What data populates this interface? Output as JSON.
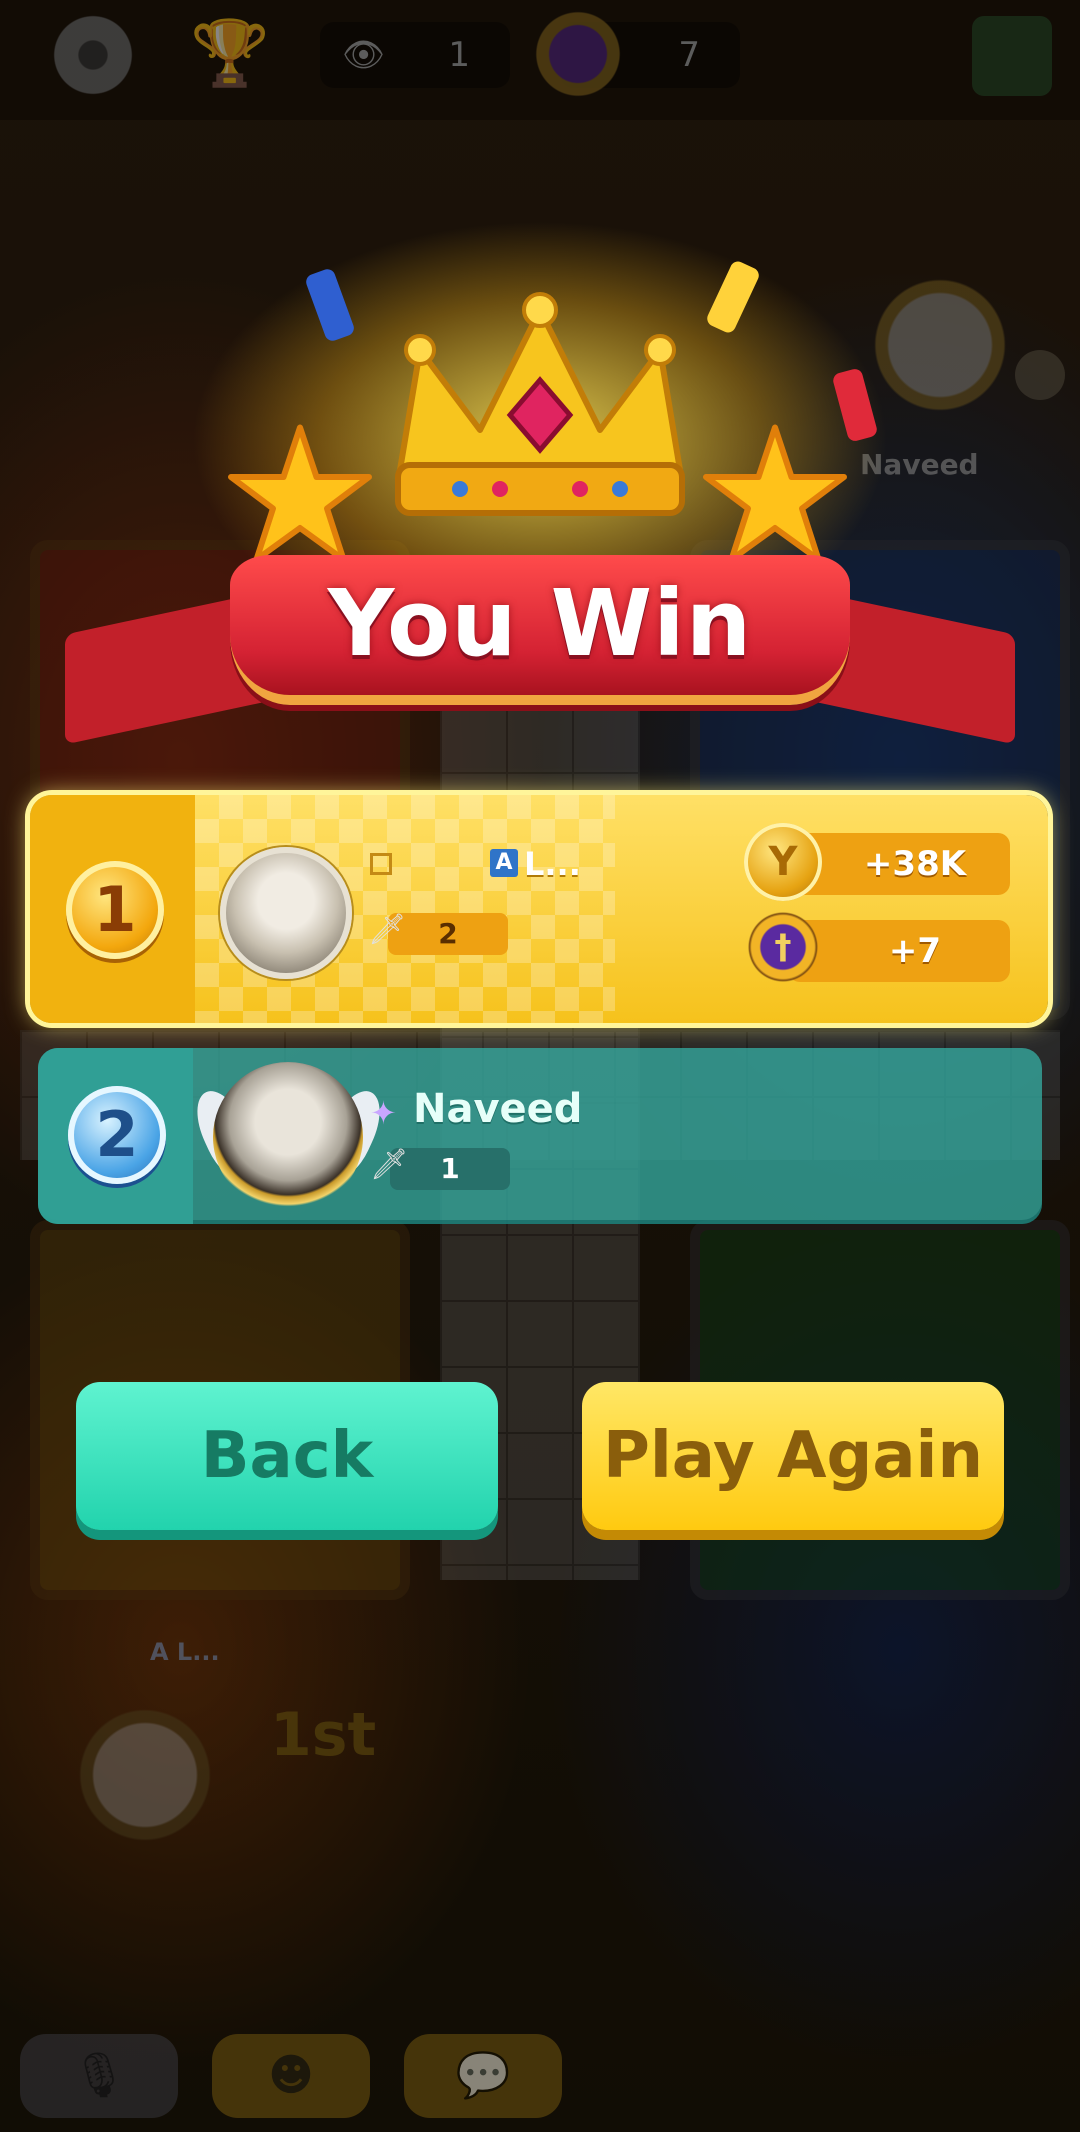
{
  "topbar": {
    "icons": [
      "gear-icon",
      "trophy-icon",
      "eye-icon",
      "sword-badge-icon",
      "gift-bag-icon"
    ],
    "viewers": "1",
    "swords": "7"
  },
  "opponent_board": {
    "name": "Naveed"
  },
  "self_board": {
    "tag": "A L...",
    "rank_label": "1st"
  },
  "result": {
    "title": "You Win",
    "players": [
      {
        "rank": "1",
        "badge_letter": "A",
        "name": "L...",
        "swords": "2",
        "coins_reward": "+38K",
        "trophy_reward": "+7"
      },
      {
        "rank": "2",
        "name": "Naveed",
        "swords": "1"
      }
    ]
  },
  "buttons": {
    "back": "Back",
    "play_again": "Play Again"
  },
  "bottom_bar": {
    "icons": [
      "mic-muted-icon",
      "emoji-icon",
      "chat-icon"
    ]
  },
  "colors": {
    "win_highlight": "#f6c21c",
    "second_row": "#34aaa0",
    "back_button": "#22d3ad",
    "play_again_button": "#ffca10",
    "ribbon": "#d42233"
  }
}
